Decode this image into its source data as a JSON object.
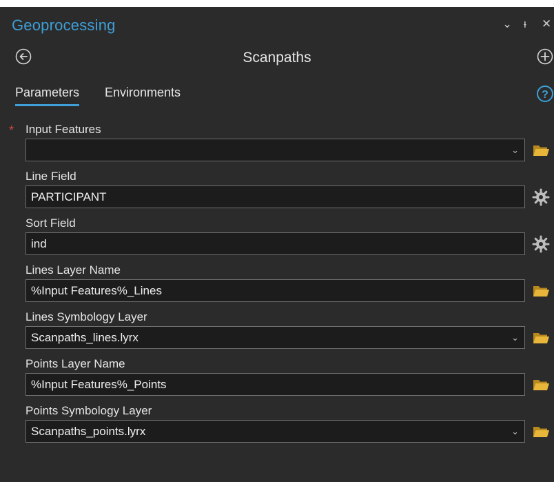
{
  "pane": {
    "title": "Geoprocessing",
    "controls": [
      "⌄",
      "ᵻ",
      "✕"
    ]
  },
  "tool": {
    "name": "Scanpaths",
    "back_icon": "back-arrow-icon",
    "add_icon": "add-icon"
  },
  "tabs": [
    {
      "label": "Parameters",
      "active": true
    },
    {
      "label": "Environments",
      "active": false
    }
  ],
  "help_icon": "help-icon",
  "parameters": [
    {
      "label": "Input Features",
      "value": "",
      "required": true,
      "type": "dropdown",
      "side_icon": "folder-icon"
    },
    {
      "label": "Line Field",
      "value": "PARTICIPANT",
      "required": false,
      "type": "text",
      "side_icon": "gear-icon"
    },
    {
      "label": "Sort Field",
      "value": "ind",
      "required": false,
      "type": "text",
      "side_icon": "gear-icon"
    },
    {
      "label": "Lines Layer Name",
      "value": "%Input Features%_Lines",
      "required": false,
      "type": "text",
      "side_icon": "folder-icon"
    },
    {
      "label": "Lines Symbology Layer",
      "value": "Scanpaths_lines.lyrx",
      "required": false,
      "type": "dropdown",
      "side_icon": "folder-icon"
    },
    {
      "label": "Points Layer Name",
      "value": "%Input Features%_Points",
      "required": false,
      "type": "text",
      "side_icon": "folder-icon"
    },
    {
      "label": "Points Symbology Layer",
      "value": "Scanpaths_points.lyrx",
      "required": false,
      "type": "dropdown",
      "side_icon": "folder-icon"
    }
  ],
  "required_marker": "*",
  "dropdown_caret": "⌄",
  "colors": {
    "background": "#2b2b2b",
    "accent": "#3e9fd9",
    "field_background": "#1c1c1c",
    "folder": "#e8b63a",
    "required": "#d04a3a"
  }
}
